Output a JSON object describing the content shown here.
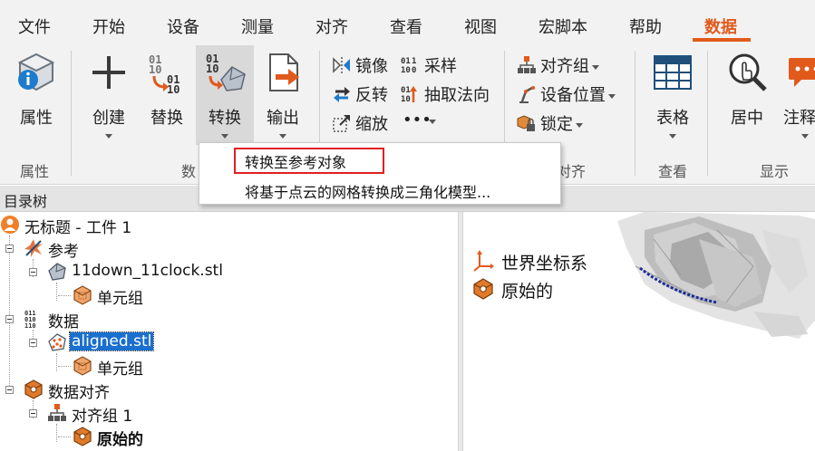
{
  "tabs": [
    {
      "label": "文件"
    },
    {
      "label": "开始"
    },
    {
      "label": "设备"
    },
    {
      "label": "测量"
    },
    {
      "label": "对齐"
    },
    {
      "label": "查看"
    },
    {
      "label": "视图"
    },
    {
      "label": "宏脚本"
    },
    {
      "label": "帮助"
    },
    {
      "label": "数据",
      "active": true
    }
  ],
  "ribbon": {
    "properties": {
      "label": "属性"
    },
    "create": {
      "label": "创建"
    },
    "replace": {
      "label": "替换"
    },
    "convert": {
      "label": "转换"
    },
    "output": {
      "label": "输出"
    },
    "mirror": {
      "label": "镜像"
    },
    "sample": {
      "label": "采样"
    },
    "reverse": {
      "label": "反转"
    },
    "extract_normal": {
      "label": "抽取法向"
    },
    "scale": {
      "label": "缩放"
    },
    "more": {
      "label": "•••"
    },
    "align_group": {
      "label": "对齐组"
    },
    "device_position": {
      "label": "设备位置"
    },
    "lock": {
      "label": "锁定"
    },
    "table": {
      "label": "表格"
    },
    "center": {
      "label": "居中"
    },
    "annotation": {
      "label": "注释"
    },
    "groups": {
      "properties": "属性",
      "data": "数",
      "align": "对齐",
      "view": "查看",
      "display": "显示"
    }
  },
  "dropdown": {
    "items": [
      {
        "label": "转换至参考对象"
      },
      {
        "label": "将基于点云的网格转换成三角化模型..."
      }
    ]
  },
  "tree": {
    "title": "目录树",
    "root": "无标题 - 工件 1",
    "reference": "参考",
    "ref_file": "11down_11clock.stl",
    "ref_element_group": "单元组",
    "data": "数据",
    "data_file": "aligned.stl",
    "data_element_group": "单元组",
    "data_alignment": "数据对齐",
    "align_group_1": "对齐组 1",
    "original": "原始的"
  },
  "viewport": {
    "world_cs": "世界坐标系",
    "original": "原始的"
  },
  "colors": {
    "accent": "#e15a1c",
    "selection": "#1a6fcf",
    "highlight_border": "#e02020"
  }
}
